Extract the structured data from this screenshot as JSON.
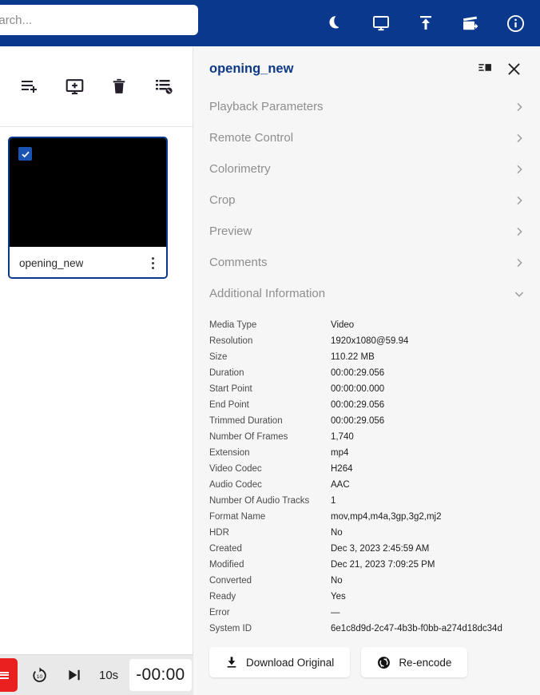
{
  "topbar": {
    "search": {
      "placeholder": "Search...",
      "value": ""
    },
    "icons": [
      {
        "name": "dark-mode-icon",
        "label": "Dark Mode"
      },
      {
        "name": "display-icon",
        "label": "Display"
      },
      {
        "name": "upload-icon",
        "label": "Upload"
      },
      {
        "name": "clapperboard-add-icon",
        "label": "Add Media"
      },
      {
        "name": "info-icon",
        "label": "Information"
      }
    ],
    "accent_color": "#09388C"
  },
  "left": {
    "toolbar": [
      {
        "name": "playlist-add-icon",
        "label": "Add To Playlist"
      },
      {
        "name": "add-to-screen-icon",
        "label": "Add To Screen"
      },
      {
        "name": "delete-icon",
        "label": "Delete"
      },
      {
        "name": "list-options-icon",
        "label": "List Options"
      }
    ],
    "card": {
      "title": "opening_new",
      "selected": true,
      "border_color": "#09388C",
      "checkbox_color": "#1b53b3"
    },
    "playbar": {
      "menu_color": "#ea2020",
      "forward_label": "Forward 10 seconds",
      "next_frame_label": "Next Frame",
      "step_label": "10s",
      "time": "-00:00"
    }
  },
  "panel": {
    "title": "opening_new",
    "header_icons": [
      {
        "name": "panel-toggle-icon",
        "label": "Toggle Panel"
      },
      {
        "name": "close-icon",
        "label": "Close"
      }
    ],
    "sections": [
      {
        "label": "Playback Parameters",
        "expanded": false
      },
      {
        "label": "Remote Control",
        "expanded": false
      },
      {
        "label": "Colorimetry",
        "expanded": false
      },
      {
        "label": "Crop",
        "expanded": false
      },
      {
        "label": "Preview",
        "expanded": false
      },
      {
        "label": "Comments",
        "expanded": false
      },
      {
        "label": "Additional Information",
        "expanded": true
      }
    ],
    "metadata": [
      {
        "key": "Media Type",
        "value": "Video"
      },
      {
        "key": "Resolution",
        "value": "1920x1080@59.94"
      },
      {
        "key": "Size",
        "value": "110.22 MB"
      },
      {
        "key": "Duration",
        "value": "00:00:29.056"
      },
      {
        "key": "Start Point",
        "value": "00:00:00.000"
      },
      {
        "key": "End Point",
        "value": "00:00:29.056"
      },
      {
        "key": "Trimmed Duration",
        "value": "00:00:29.056"
      },
      {
        "key": "Number Of Frames",
        "value": "1,740"
      },
      {
        "key": "Extension",
        "value": "mp4"
      },
      {
        "key": "Video Codec",
        "value": "H264"
      },
      {
        "key": "Audio Codec",
        "value": "AAC"
      },
      {
        "key": "Number Of Audio Tracks",
        "value": "1"
      },
      {
        "key": "Format Name",
        "value": "mov,mp4,m4a,3gp,3g2,mj2"
      },
      {
        "key": "HDR",
        "value": "No"
      },
      {
        "key": "Created",
        "value": "Dec 3, 2023 2:45:59 AM"
      },
      {
        "key": "Modified",
        "value": "Dec 21, 2023 7:09:25 PM"
      },
      {
        "key": "Converted",
        "value": "No"
      },
      {
        "key": "Ready",
        "value": "Yes"
      },
      {
        "key": "Error",
        "value": "—"
      },
      {
        "key": "System ID",
        "value": "6e1c8d9d-2c47-4b3b-f0bb-a274d18dc34d"
      }
    ],
    "actions": [
      {
        "label": "Download Original",
        "icon": "download-icon"
      },
      {
        "label": "Re-encode",
        "icon": "re-encode-icon"
      }
    ]
  }
}
